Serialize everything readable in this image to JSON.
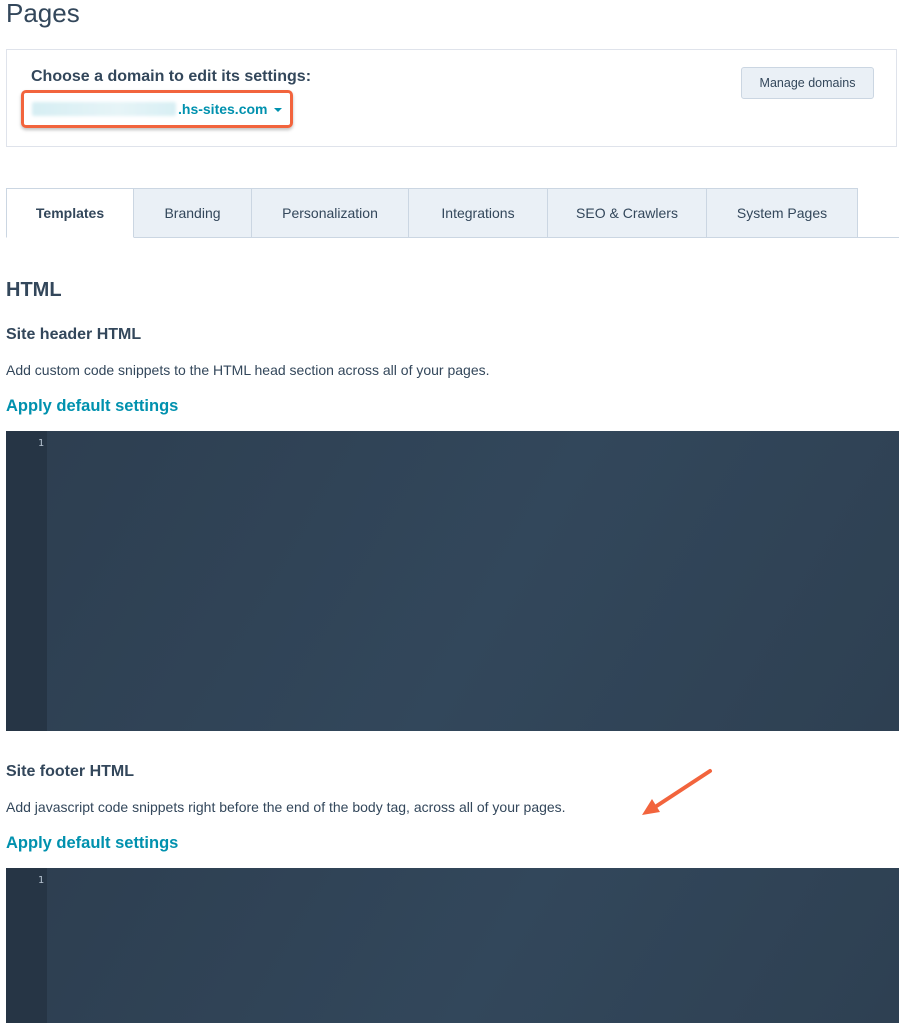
{
  "page": {
    "title": "Pages"
  },
  "domain": {
    "label": "Choose a domain to edit its settings:",
    "selected_suffix": ".hs-sites.com",
    "manage_button": "Manage domains"
  },
  "tabs": [
    {
      "label": "Templates",
      "active": true
    },
    {
      "label": "Branding",
      "active": false
    },
    {
      "label": "Personalization",
      "active": false
    },
    {
      "label": "Integrations",
      "active": false
    },
    {
      "label": "SEO & Crawlers",
      "active": false
    },
    {
      "label": "System Pages",
      "active": false
    }
  ],
  "html_section": {
    "title": "HTML",
    "header": {
      "title": "Site header HTML",
      "description": "Add custom code snippets to the HTML head section across all of your pages.",
      "apply_link": "Apply default settings",
      "line_number": "1"
    },
    "footer": {
      "title": "Site footer HTML",
      "description": "Add javascript code snippets right before the end of the body tag, across all of your pages.",
      "apply_link": "Apply default settings",
      "line_number": "1"
    }
  },
  "colors": {
    "accent_link": "#0091ae",
    "highlight": "#f2643d",
    "editor_bg": "#2d3e50"
  },
  "icons": [
    "caret-down-icon",
    "annotation-arrow-icon"
  ]
}
